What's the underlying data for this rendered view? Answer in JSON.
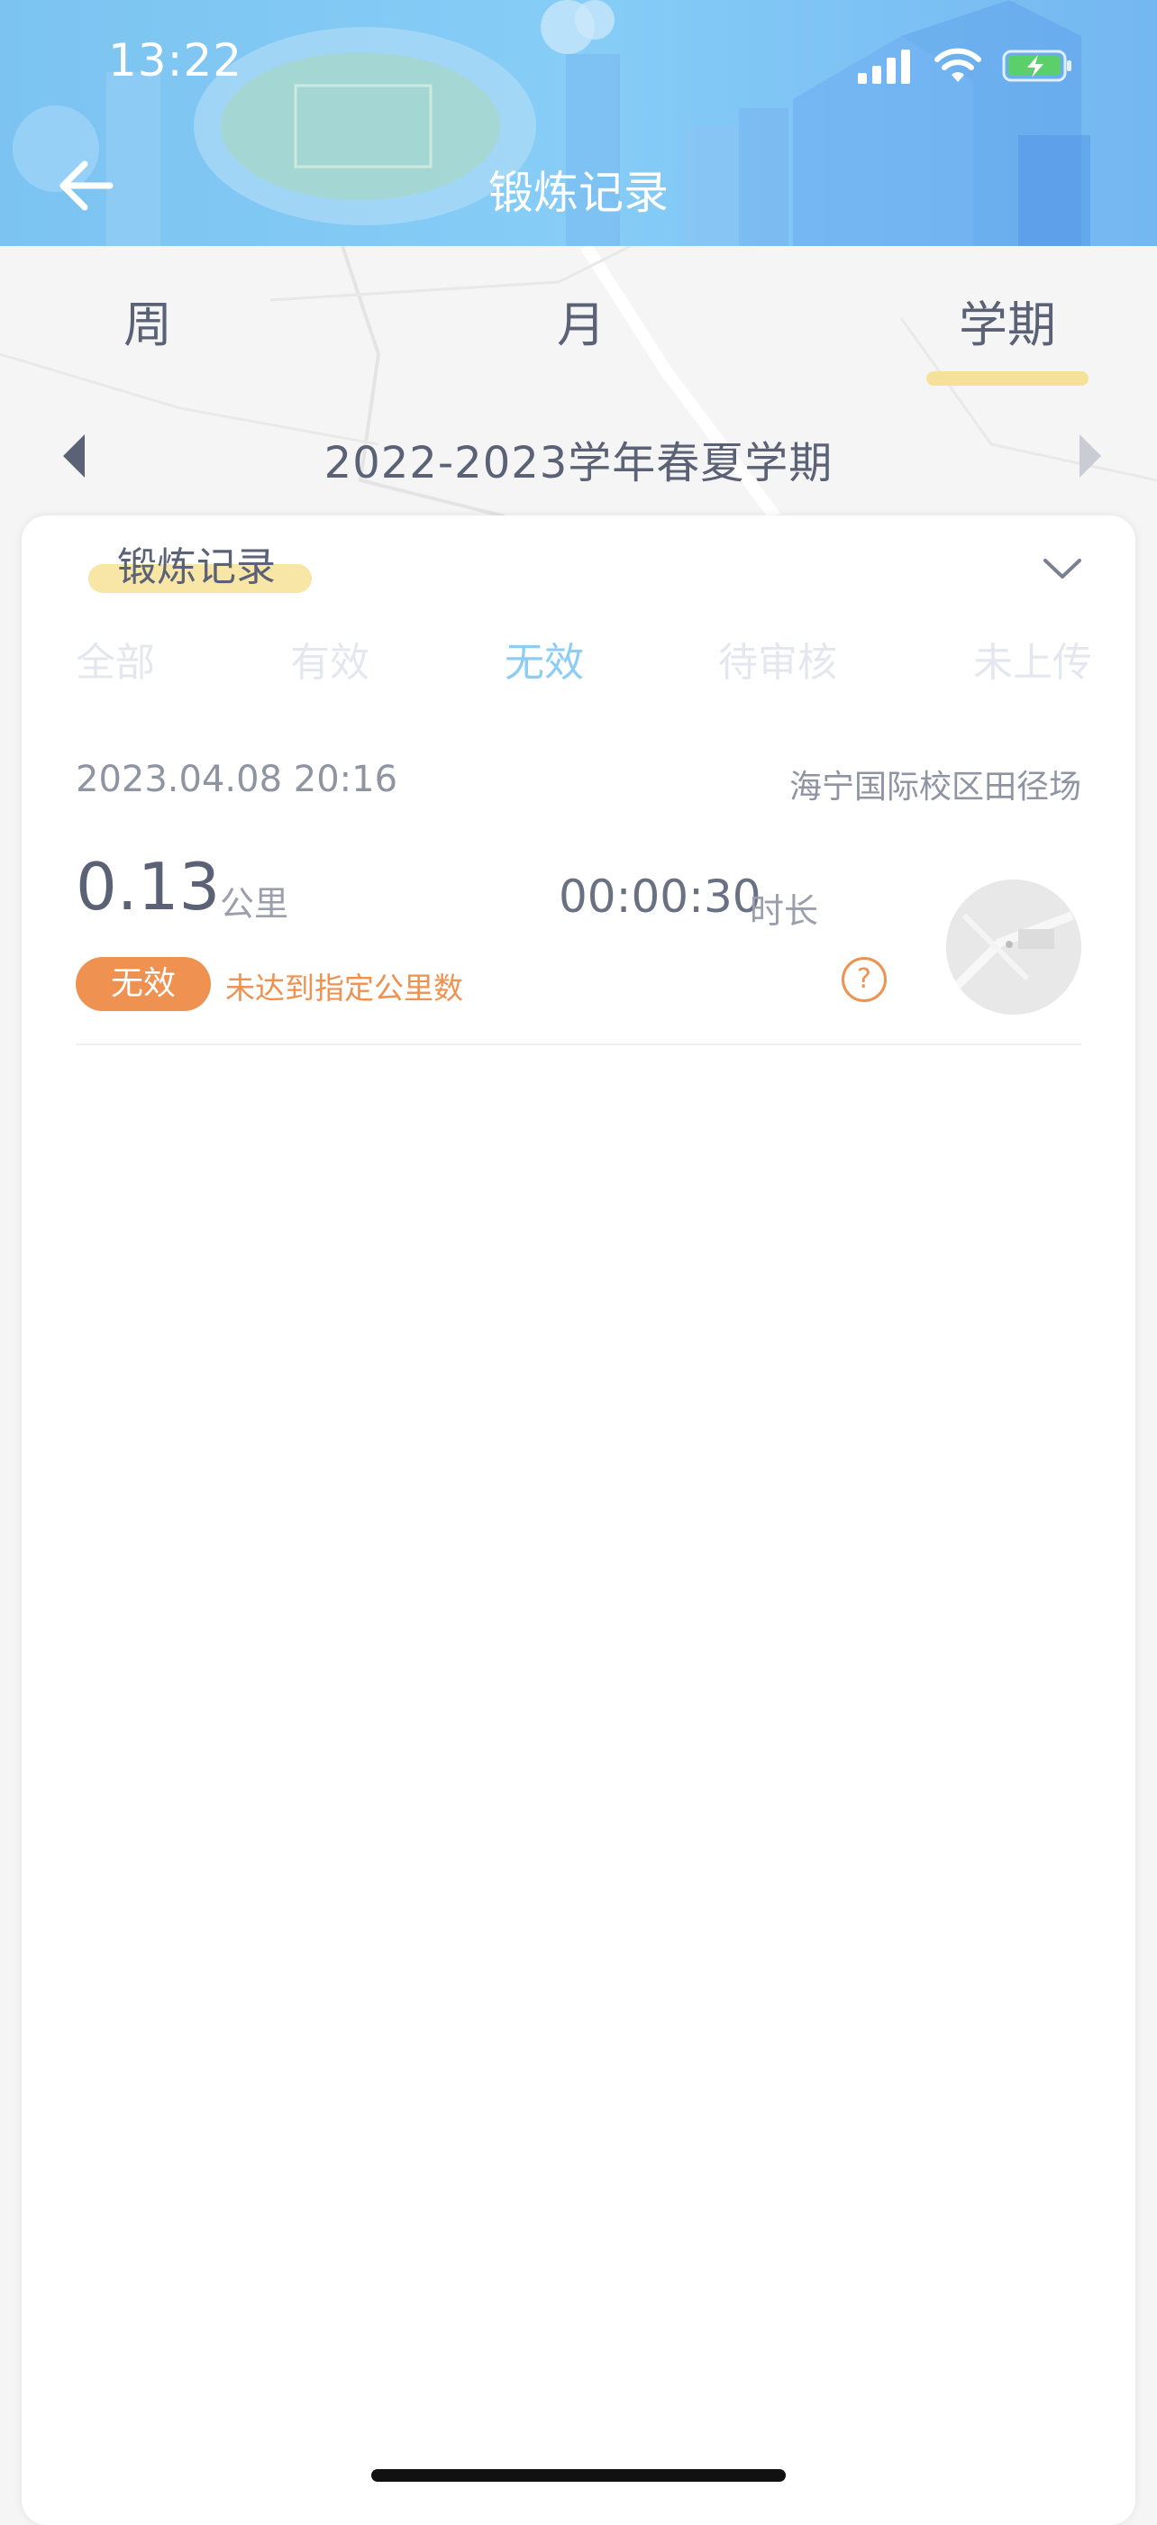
{
  "status_bar": {
    "time": "13:22"
  },
  "header": {
    "title": "锻炼记录"
  },
  "period_tabs": [
    {
      "label": "周",
      "active": false
    },
    {
      "label": "月",
      "active": false
    },
    {
      "label": "学期",
      "active": true
    }
  ],
  "term": {
    "label": "2022-2023学年春夏学期"
  },
  "card": {
    "title": "锻炼记录",
    "filter_tabs": [
      {
        "label": "全部",
        "active": false
      },
      {
        "label": "有效",
        "active": false
      },
      {
        "label": "无效",
        "active": true
      },
      {
        "label": "待审核",
        "active": false
      },
      {
        "label": "未上传",
        "active": false
      }
    ]
  },
  "record": {
    "datetime": "2023.04.08 20:16",
    "location": "海宁国际校区田径场",
    "distance": "0.13",
    "distance_unit": "公里",
    "duration": "00:00:30",
    "duration_unit": "时长",
    "status": "无效",
    "reason": "未达到指定公里数",
    "help_symbol": "?"
  },
  "colors": {
    "header_blue": "#86cdf7",
    "active_filter": "#8ccdf6",
    "invalid_orange": "#ef9150",
    "highlight_yellow": "#f6e19a"
  },
  "icons": [
    "back-arrow-icon",
    "signal-icon",
    "wifi-icon",
    "battery-charging-icon",
    "chevron-down-icon",
    "caret-left-icon",
    "caret-right-icon",
    "help-icon"
  ]
}
